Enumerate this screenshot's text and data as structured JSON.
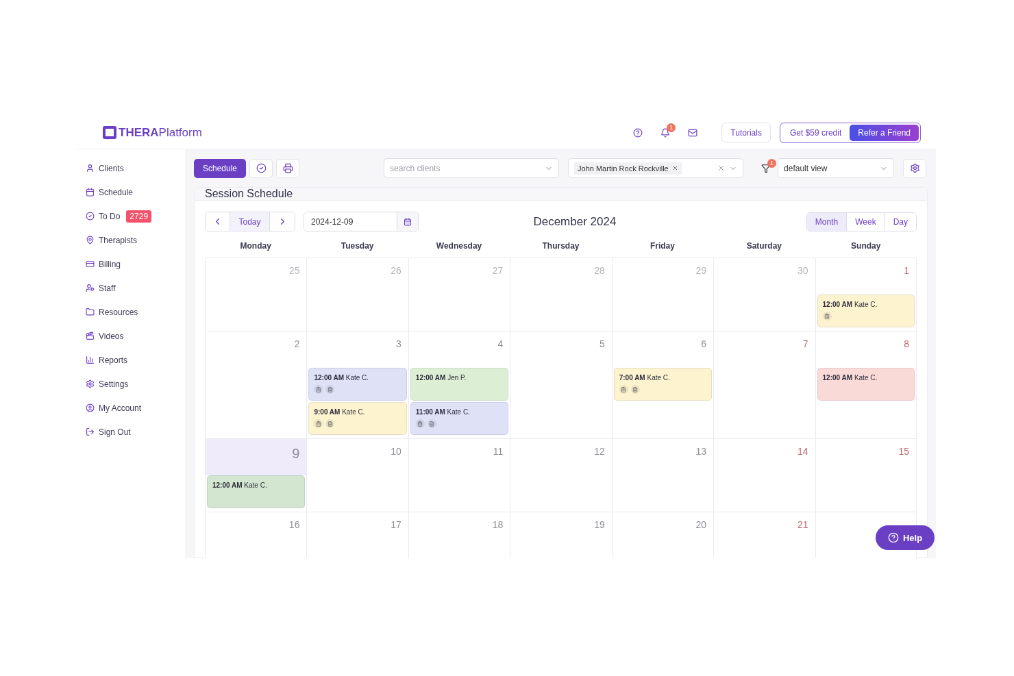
{
  "logo": "**THERA**Platform",
  "header": {
    "notification_count": "1",
    "tutorials": "Tutorials",
    "credit": "Get $59 credit",
    "refer": "Refer a Friend"
  },
  "sidebar": {
    "items": [
      {
        "label": "Clients"
      },
      {
        "label": "Schedule"
      },
      {
        "label": "To Do",
        "badge": "2729"
      },
      {
        "label": "Therapists"
      },
      {
        "label": "Billing"
      },
      {
        "label": "Staff"
      },
      {
        "label": "Resources"
      },
      {
        "label": "Videos"
      },
      {
        "label": "Reports"
      },
      {
        "label": "Settings"
      },
      {
        "label": "My Account"
      },
      {
        "label": "Sign Out"
      }
    ]
  },
  "toolbar": {
    "schedule": "Schedule",
    "search": {
      "placeholder": "search clients"
    },
    "client_tag": "John Martin Rock Rockville",
    "filter_count": "1",
    "view": "default view"
  },
  "panel": {
    "title": "Session Schedule",
    "today": "Today",
    "date": "2024-12-09",
    "month_title": "December 2024",
    "views": [
      {
        "label": "Month",
        "selected": true
      },
      {
        "label": "Week",
        "selected": false
      },
      {
        "label": "Day",
        "selected": false
      }
    ]
  },
  "weekdays": [
    "Monday",
    "Tuesday",
    "Wednesday",
    "Thursday",
    "Friday",
    "Saturday",
    "Sunday"
  ],
  "weeks": [
    [
      {
        "number": "25",
        "kind": "other",
        "today": false
      },
      {
        "number": "26",
        "kind": "other",
        "today": false
      },
      {
        "number": "27",
        "kind": "other",
        "today": false
      },
      {
        "number": "28",
        "kind": "other",
        "today": false
      },
      {
        "number": "29",
        "kind": "other",
        "today": false
      },
      {
        "number": "30",
        "kind": "other",
        "today": false
      },
      {
        "number": "1",
        "kind": "weekend",
        "today": false,
        "events": [
          {
            "time": "12:00 AM",
            "person": "Kate C.",
            "color": "#fdf3cf",
            "has_note": true,
            "has_document": false
          }
        ]
      }
    ],
    [
      {
        "number": "2",
        "kind": "weekday",
        "today": false
      },
      {
        "number": "3",
        "kind": "weekday",
        "today": false,
        "events": [
          {
            "time": "12:00 AM",
            "person": "Kate C.",
            "color": "#dfe1f7",
            "has_note": true,
            "has_document": true
          },
          {
            "time": "9:00 AM",
            "person": "Kate C.",
            "color": "#fdf3cf",
            "has_note": true,
            "has_document": true
          }
        ]
      },
      {
        "number": "4",
        "kind": "weekday",
        "today": false,
        "events": [
          {
            "time": "12:00 AM",
            "person": "Jen P.",
            "color": "#dcefd5",
            "has_note": false,
            "has_document": false
          },
          {
            "time": "11:00 AM",
            "person": "Kate C.",
            "color": "#dfe1f7",
            "has_note": true,
            "has_document": true
          }
        ]
      },
      {
        "number": "5",
        "kind": "weekday",
        "today": false
      },
      {
        "number": "6",
        "kind": "weekday",
        "today": false,
        "events": [
          {
            "time": "7:00 AM",
            "person": "Kate C.",
            "color": "#fdf3cf",
            "has_note": true,
            "has_document": true
          }
        ]
      },
      {
        "number": "7",
        "kind": "weekend",
        "today": false
      },
      {
        "number": "8",
        "kind": "weekend",
        "today": false,
        "events": [
          {
            "time": "12:00 AM",
            "person": "Kate C.",
            "color": "#fadad6",
            "has_note": false,
            "has_document": false
          }
        ]
      }
    ],
    [
      {
        "number": "9",
        "kind": "weekday",
        "today": true,
        "events": [
          {
            "time": "12:00 AM",
            "person": "Kate C.",
            "color": "#d3e6d0",
            "has_note": false,
            "has_document": false
          }
        ]
      },
      {
        "number": "10",
        "kind": "weekday",
        "today": false
      },
      {
        "number": "11",
        "kind": "weekday",
        "today": false
      },
      {
        "number": "12",
        "kind": "weekday",
        "today": false
      },
      {
        "number": "13",
        "kind": "weekday",
        "today": false
      },
      {
        "number": "14",
        "kind": "weekend",
        "today": false
      },
      {
        "number": "15",
        "kind": "weekend",
        "today": false
      }
    ],
    [
      {
        "number": "16",
        "kind": "weekday",
        "today": false
      },
      {
        "number": "17",
        "kind": "weekday",
        "today": false
      },
      {
        "number": "18",
        "kind": "weekday",
        "today": false
      },
      {
        "number": "19",
        "kind": "weekday",
        "today": false
      },
      {
        "number": "20",
        "kind": "weekday",
        "today": false
      },
      {
        "number": "21",
        "kind": "weekend",
        "today": false
      },
      {
        "today": false
      }
    ]
  ],
  "help": "Help"
}
